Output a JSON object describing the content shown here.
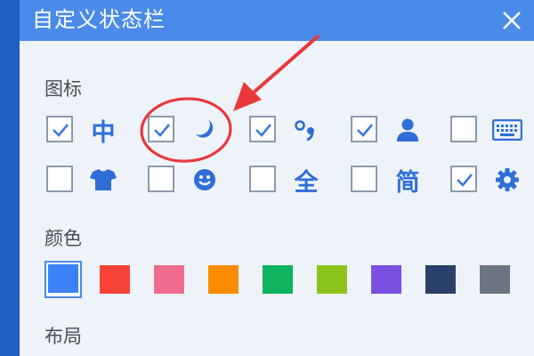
{
  "window": {
    "title": "自定义状态栏"
  },
  "sections": {
    "icons": "图标",
    "colors": "颜色",
    "layout": "布局"
  },
  "icons": [
    {
      "name": "chinese-mode",
      "label": "中",
      "checked": true
    },
    {
      "name": "moon",
      "label": "",
      "checked": true
    },
    {
      "name": "punctuation",
      "label": "",
      "checked": true
    },
    {
      "name": "user",
      "label": "",
      "checked": true
    },
    {
      "name": "keyboard",
      "label": "",
      "checked": false
    },
    {
      "name": "skin",
      "label": "",
      "checked": false
    },
    {
      "name": "emoji",
      "label": "",
      "checked": false
    },
    {
      "name": "full-width",
      "label": "全",
      "checked": false
    },
    {
      "name": "simplified",
      "label": "简",
      "checked": false
    },
    {
      "name": "settings",
      "label": "",
      "checked": true
    }
  ],
  "colors": {
    "selected_index": 0,
    "swatches": [
      "#3b82f6",
      "#f44336",
      "#f06c8f",
      "#fb8c00",
      "#0eb35e",
      "#8bc31a",
      "#7b4fe0",
      "#2b3f6b",
      "#6e7582"
    ]
  },
  "theme": {
    "accent": "#4a8bea",
    "icon_color": "#2f6ed6",
    "annotation": "#e8383b"
  }
}
